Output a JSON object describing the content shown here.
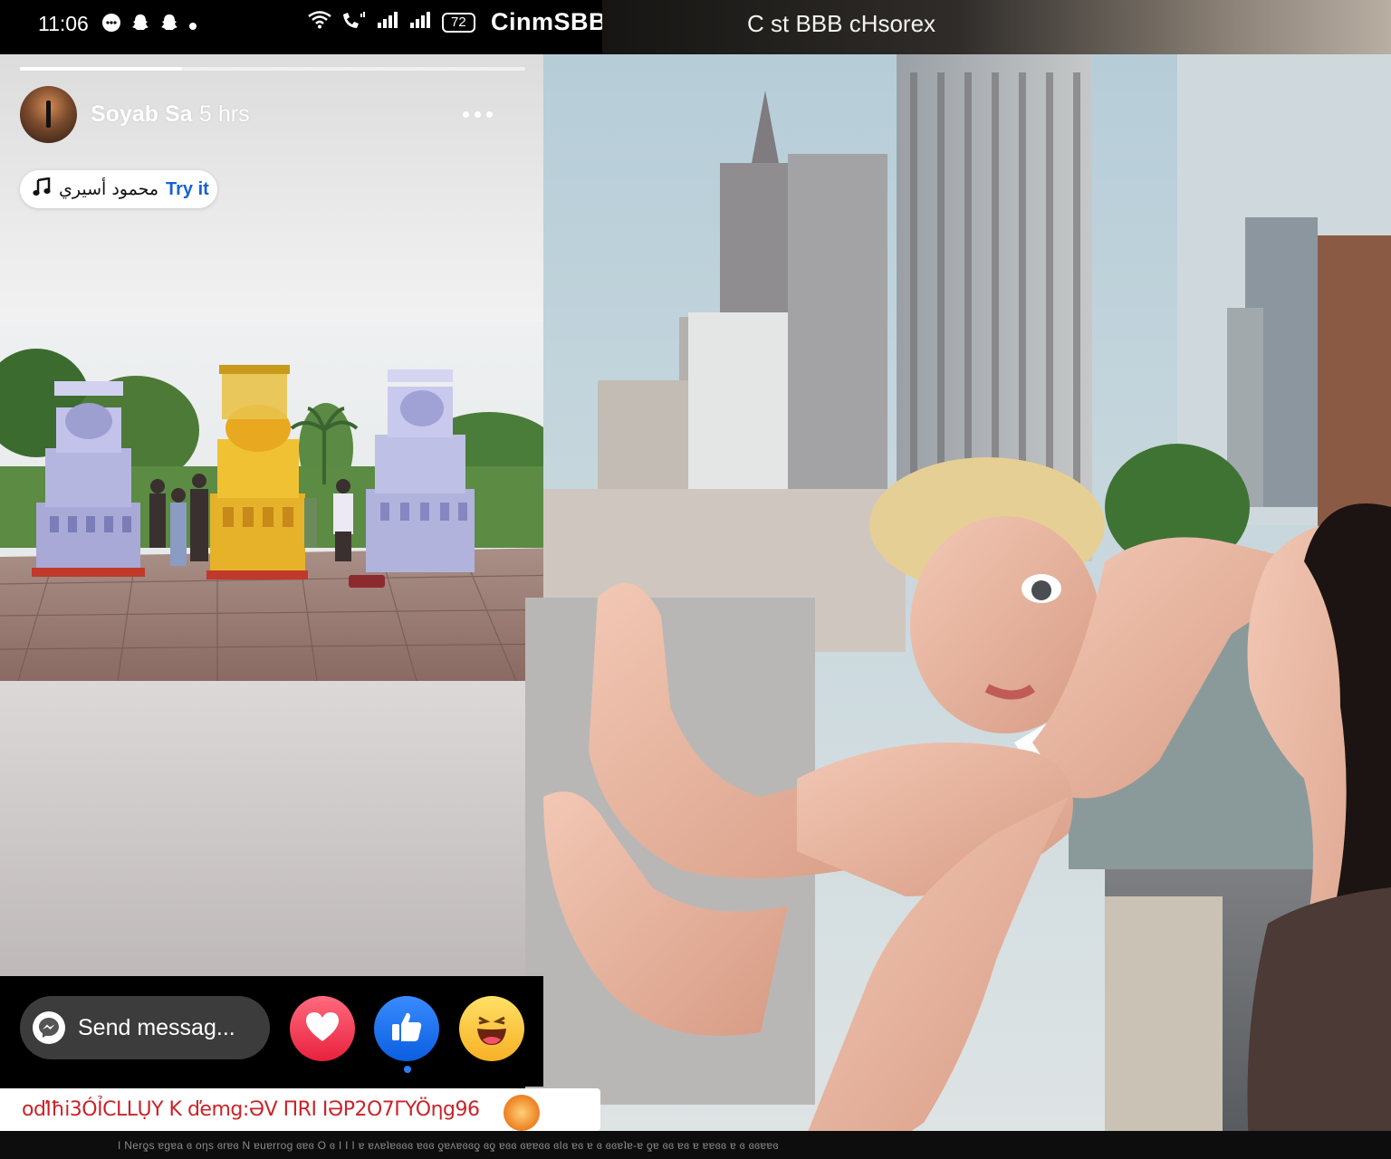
{
  "status_bar": {
    "time": "11:06",
    "notification_icons": [
      "messenger-icon",
      "snapchat-icon",
      "snapchat-icon",
      "dot-icon"
    ],
    "battery": "72",
    "carrier_label": "CinmSBB"
  },
  "top_right": {
    "title": "C st BBB cHsorex"
  },
  "story": {
    "progress_fraction": 0.32,
    "user_name": "Soyab Sa",
    "time_ago": "5 hrs",
    "music": {
      "song": "محمود أسيري",
      "action": "Try it"
    }
  },
  "bottom": {
    "send_message_label": "Send messag...",
    "reactions": [
      "love",
      "like",
      "haha"
    ],
    "caption_strip": "oďIħi3ÓỈCLLỤY K ďemg:ƏV ΠRΙ IƏP2O7ΓYÖηg96",
    "footer_text": "I Nerƍs ɐgɐa ɞ oηs ɞrɐɞ   N ɐuɐrrog ɞɐɞ O ɞ I I I ɐ ɐʌɐʇɐɞɞɞ ɐɞɞ  ƍɐʌɐɞɞƍ  ɞƍ ɐɞɞ ɞɐɐɞɞ  ɞIɞ ɐɞ ɐ ɞ ɞɞɐʇɐ-ɐ ƍɐ ɞɞ ɐɞ ɐ ɐɐɞɞ ɐ ɞ ɞɞɐɐɞ"
  },
  "colors": {
    "accent_blue": "#1763cf",
    "like_blue": "#0a5fe0",
    "love_red": "#e8213e",
    "haha_yellow": "#f7b125",
    "caption_red": "#c8242a"
  }
}
